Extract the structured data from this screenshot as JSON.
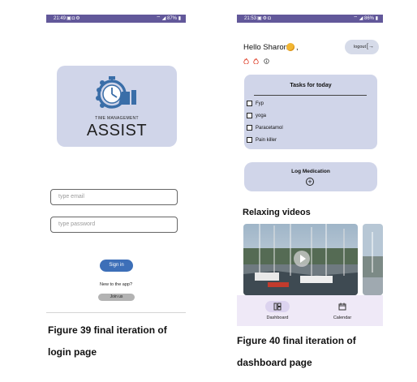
{
  "login_screen": {
    "status_bar": {
      "time": "21:49",
      "icons": [
        "image-icon",
        "alarm-icon",
        "settings-icon"
      ],
      "battery": "87%"
    },
    "logo": {
      "line1": "TIME MANAGEMENT",
      "line2": "ASSIST"
    },
    "email_input": {
      "placeholder": "type email"
    },
    "password_input": {
      "placeholder": "type password"
    },
    "signin_button": "Sign in",
    "new_to_app_text": "New to the app?",
    "join_us_button": "Join us"
  },
  "login_caption": {
    "line1": "Figure 39 final iteration of",
    "line2": "login page"
  },
  "dashboard_screen": {
    "status_bar": {
      "time": "21:53",
      "icons": [
        "image-icon",
        "settings-icon",
        "alarm-icon"
      ],
      "battery": "86%"
    },
    "greeting": "Hello Sharon",
    "greeting_suffix": ",",
    "logout_button": "logout",
    "streak_icons": [
      "flame-icon",
      "flame-icon",
      "info-icon"
    ],
    "tasks_card": {
      "title": "Tasks for today",
      "tasks": [
        "Fyp",
        "yoga",
        "Paracetamol",
        "Pain killer"
      ]
    },
    "log_medication": {
      "title": "Log Medication",
      "icon": "add-circle-icon"
    },
    "videos_section_title": "Relaxing videos",
    "bottom_nav": [
      {
        "label": "Dashboard",
        "icon": "dashboard-icon",
        "active": true
      },
      {
        "label": "Calendar",
        "icon": "calendar-edit-icon",
        "active": false
      }
    ]
  },
  "dashboard_caption": {
    "line1": "Figure 40 final iteration of",
    "line2": "dashboard page"
  },
  "colors": {
    "status_bar": "#62589a",
    "card_background": "#d0d5e9",
    "signin_button": "#3d6fb8",
    "logo_icon": "#3a6ea8",
    "nav_background": "#efe9f7",
    "nav_active_pill": "#dcd3ef"
  }
}
